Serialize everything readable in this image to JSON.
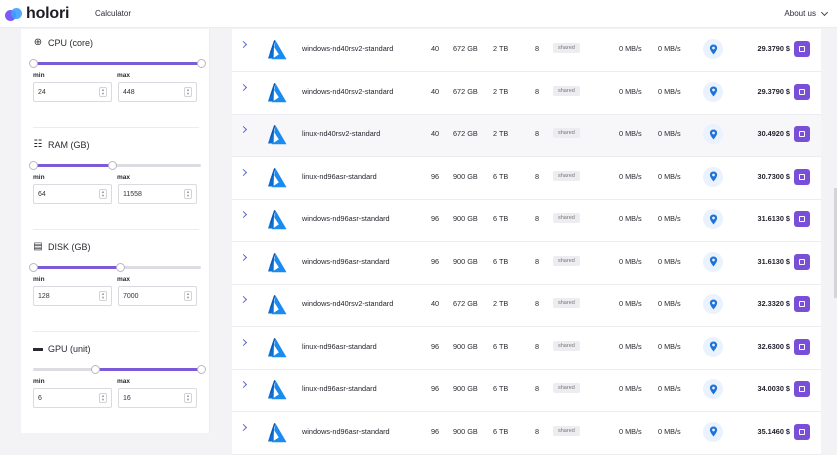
{
  "header": {
    "logo_text": "holori",
    "nav_calculator": "Calculator",
    "about_label": "About us"
  },
  "filters": [
    {
      "key": "cpu",
      "title": "CPU (core)",
      "icon": "chip-icon",
      "range_fraction": [
        0.0,
        1.0
      ],
      "min_label": "min",
      "max_label": "max",
      "min_value": "24",
      "max_value": "448"
    },
    {
      "key": "ram",
      "title": "RAM (GB)",
      "icon": "memory-icon",
      "range_fraction": [
        0.0,
        0.47
      ],
      "min_label": "min",
      "max_label": "max",
      "min_value": "64",
      "max_value": "11558"
    },
    {
      "key": "disk",
      "title": "DISK (GB)",
      "icon": "disk-icon",
      "range_fraction": [
        0.0,
        0.52
      ],
      "min_label": "min",
      "max_label": "max",
      "min_value": "128",
      "max_value": "7000"
    },
    {
      "key": "gpu",
      "title": "GPU (unit)",
      "icon": "gpu-icon",
      "range_fraction": [
        0.37,
        1.0
      ],
      "min_label": "min",
      "max_label": "max",
      "min_value": "6",
      "max_value": "16"
    }
  ],
  "rows": [
    {
      "name": "windows-nd40rsv2-standard",
      "cpu": "40",
      "ram": "672 GB",
      "disk": "2 TB",
      "gpu": "8",
      "badge": "shared",
      "net_in": "0 MB/s",
      "net_out": "0 MB/s",
      "price": "29.3790 $"
    },
    {
      "name": "windows-nd40rsv2-standard",
      "cpu": "40",
      "ram": "672 GB",
      "disk": "2 TB",
      "gpu": "8",
      "badge": "shared",
      "net_in": "0 MB/s",
      "net_out": "0 MB/s",
      "price": "29.3790 $"
    },
    {
      "name": "linux-nd40rsv2-standard",
      "cpu": "40",
      "ram": "672 GB",
      "disk": "2 TB",
      "gpu": "8",
      "badge": "shared",
      "net_in": "0 MB/s",
      "net_out": "0 MB/s",
      "price": "30.4920 $"
    },
    {
      "name": "linux-nd96asr-standard",
      "cpu": "96",
      "ram": "900 GB",
      "disk": "6 TB",
      "gpu": "8",
      "badge": "shared",
      "net_in": "0 MB/s",
      "net_out": "0 MB/s",
      "price": "30.7300 $"
    },
    {
      "name": "windows-nd96asr-standard",
      "cpu": "96",
      "ram": "900 GB",
      "disk": "6 TB",
      "gpu": "8",
      "badge": "shared",
      "net_in": "0 MB/s",
      "net_out": "0 MB/s",
      "price": "31.6130 $"
    },
    {
      "name": "windows-nd96asr-standard",
      "cpu": "96",
      "ram": "900 GB",
      "disk": "6 TB",
      "gpu": "8",
      "badge": "shared",
      "net_in": "0 MB/s",
      "net_out": "0 MB/s",
      "price": "31.6130 $"
    },
    {
      "name": "windows-nd40rsv2-standard",
      "cpu": "40",
      "ram": "672 GB",
      "disk": "2 TB",
      "gpu": "8",
      "badge": "shared",
      "net_in": "0 MB/s",
      "net_out": "0 MB/s",
      "price": "32.3320 $"
    },
    {
      "name": "linux-nd96asr-standard",
      "cpu": "96",
      "ram": "900 GB",
      "disk": "6 TB",
      "gpu": "8",
      "badge": "shared",
      "net_in": "0 MB/s",
      "net_out": "0 MB/s",
      "price": "32.6300 $"
    },
    {
      "name": "linux-nd96asr-standard",
      "cpu": "96",
      "ram": "900 GB",
      "disk": "6 TB",
      "gpu": "8",
      "badge": "shared",
      "net_in": "0 MB/s",
      "net_out": "0 MB/s",
      "price": "34.0030 $"
    },
    {
      "name": "windows-nd96asr-standard",
      "cpu": "96",
      "ram": "900 GB",
      "disk": "6 TB",
      "gpu": "8",
      "badge": "shared",
      "net_in": "0 MB/s",
      "net_out": "0 MB/s",
      "price": "35.1460 $"
    }
  ],
  "colors": {
    "accent": "#7b5cd6",
    "add_button": "#7a4fd8",
    "azure_blue": "#0a6fd6",
    "pin_blue": "#1e73d8"
  }
}
